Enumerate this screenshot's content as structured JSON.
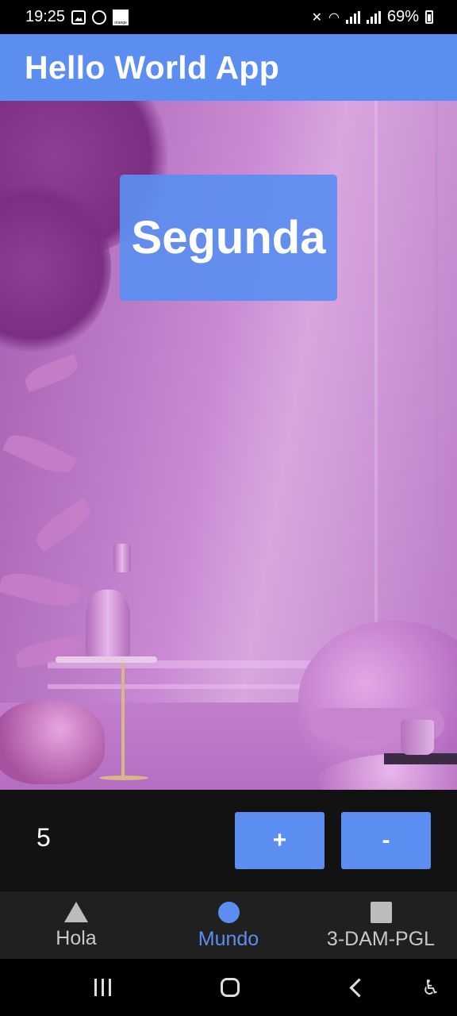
{
  "status_bar": {
    "time": "19:25",
    "battery": "69%",
    "carrier_badge": "orange"
  },
  "app_bar": {
    "title": "Hello World App"
  },
  "main": {
    "segunda_label": "Segunda"
  },
  "counter": {
    "value": "5",
    "increment_label": "+",
    "decrement_label": "-"
  },
  "bottom_nav": {
    "items": [
      {
        "label": "Hola",
        "icon": "triangle-icon",
        "active": false
      },
      {
        "label": "Mundo",
        "icon": "circle-icon",
        "active": true
      },
      {
        "label": "3-DAM-PGL",
        "icon": "square-icon",
        "active": false
      }
    ]
  },
  "colors": {
    "accent": "#5b8ef0",
    "counter_bg": "#121212",
    "nav_bg": "#202020"
  }
}
